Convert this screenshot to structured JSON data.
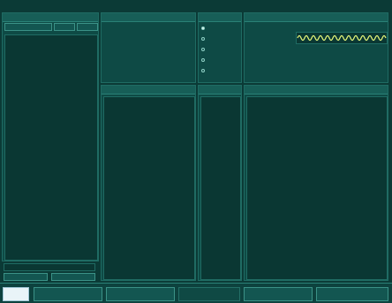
{
  "source": {
    "title": "",
    "buttons": [
      "",
      "",
      ""
    ],
    "lines": []
  },
  "components": {
    "title": "",
    "rows": []
  },
  "control": {
    "title": "",
    "options": []
  },
  "readout": {
    "title": "",
    "columns": [],
    "wave_label": "",
    "rows": []
  },
  "tree": {
    "title": "",
    "lines": []
  },
  "middle_list": {
    "title": ""
  },
  "log": {
    "title": "",
    "lines": []
  },
  "input": {
    "value": "",
    "placeholder": ""
  },
  "bottom_tools": {
    "left": "",
    "right": ""
  },
  "footer": {
    "logo": "",
    "buttons": [
      "",
      "",
      "",
      "",
      ""
    ]
  },
  "colors": {
    "background": "#0b3a36",
    "panel": "#0e4a45",
    "wave": "#e6f77a"
  }
}
